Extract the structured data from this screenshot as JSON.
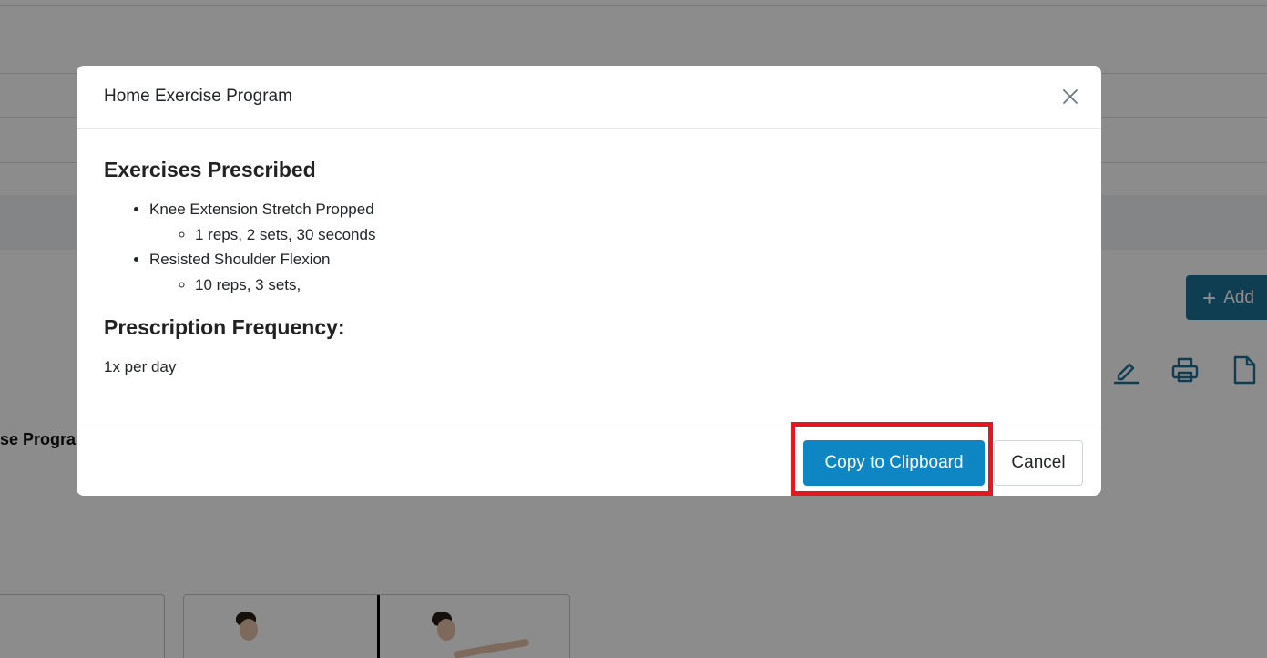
{
  "background": {
    "add_button": {
      "icon": "plus-icon",
      "label": "Add"
    },
    "toolbar_icons": [
      "edit-icon",
      "printer-icon",
      "document-icon"
    ],
    "partial_title": "se Progra",
    "accent_color": "#1d6f96"
  },
  "modal": {
    "title": "Home Exercise Program",
    "close_icon": "close-icon",
    "exercises_heading": "Exercises Prescribed",
    "exercises": [
      {
        "name": "Knee Extension Stretch Propped",
        "detail": "1 reps, 2 sets, 30 seconds"
      },
      {
        "name": "Resisted Shoulder Flexion",
        "detail": "10 reps, 3 sets,"
      }
    ],
    "frequency_heading": "Prescription Frequency:",
    "frequency_value": "1x per day",
    "copy_button": "Copy to Clipboard",
    "cancel_button": "Cancel",
    "primary_color": "#0e86c3",
    "highlight_color": "#e0191f"
  }
}
